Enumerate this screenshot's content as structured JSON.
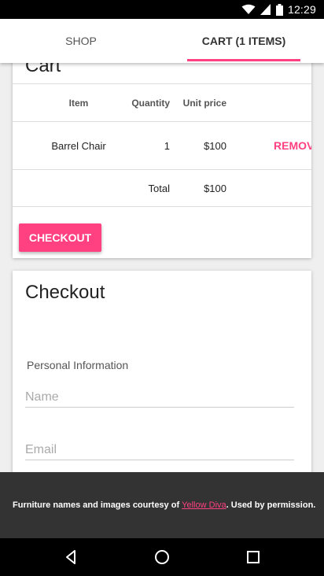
{
  "status_bar": {
    "time": "12:29",
    "icons": [
      "wifi-icon",
      "signal-icon",
      "battery-icon"
    ]
  },
  "tabs": [
    {
      "label": "SHOP",
      "selected": false
    },
    {
      "label": "CART (1 ITEMS)",
      "selected": true
    }
  ],
  "cart": {
    "title": "Cart",
    "columns": {
      "item": "Item",
      "quantity": "Quantity",
      "unit_price": "Unit price"
    },
    "rows": [
      {
        "item": "Barrel Chair",
        "quantity": "1",
        "unit_price": "$100",
        "action": "REMOVE"
      }
    ],
    "total_label": "Total",
    "total_value": "$100",
    "checkout_label": "CHECKOUT"
  },
  "checkout": {
    "title": "Checkout",
    "section_label": "Personal Information",
    "name_placeholder": "Name",
    "email_placeholder": "Email"
  },
  "snackbar": {
    "prefix": "Furniture names and images courtesy of ",
    "link_text": "Yellow Diva",
    "suffix": ". Used by permission."
  },
  "nav_bar": {
    "buttons": [
      "back-icon",
      "home-icon",
      "recents-icon"
    ]
  },
  "colors": {
    "accent": "#ff4081",
    "status_bar": "#000000",
    "snackbar": "#333333"
  }
}
